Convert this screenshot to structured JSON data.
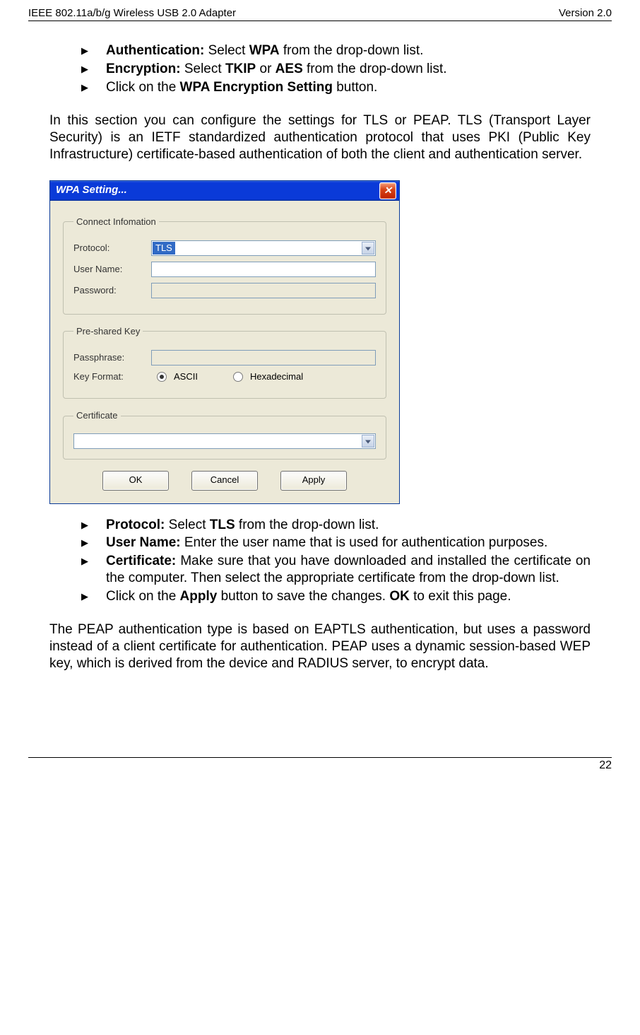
{
  "header": {
    "left": "IEEE 802.11a/b/g Wireless USB 2.0 Adapter",
    "right": "Version 2.0"
  },
  "bullets_top": [
    {
      "bold": "Authentication:",
      "rest": " Select ",
      "bold2": "WPA",
      "tail": " from the drop-down list."
    },
    {
      "bold": "Encryption:",
      "rest": " Select ",
      "bold2": "TKIP",
      "mid": " or ",
      "bold3": "AES",
      "tail": " from the drop-down list."
    },
    {
      "plain": "Click on the ",
      "bold2": "WPA Encryption Setting",
      "tail": " button."
    }
  ],
  "para1": "In this section you can configure the settings for TLS or PEAP.  TLS (Transport Layer Security) is an IETF standardized authentication protocol that uses PKI (Public Key Infrastructure) certificate-based authentication of both the client and authentication server.",
  "dialog": {
    "title": "WPA Setting...",
    "group1": {
      "legend": "Connect Infomation",
      "protocol_label": "Protocol:",
      "protocol_value": "TLS",
      "username_label": "User Name:",
      "password_label": "Password:"
    },
    "group2": {
      "legend": "Pre-shared Key",
      "passphrase_label": "Passphrase:",
      "keyformat_label": "Key Format:",
      "opt_ascii": "ASCII",
      "opt_hex": "Hexadecimal"
    },
    "group3": {
      "legend": "Certificate"
    },
    "buttons": {
      "ok": "OK",
      "cancel": "Cancel",
      "apply": "Apply"
    }
  },
  "bullets_bottom": {
    "b1_bold": "Protocol:",
    "b1_rest": " Select ",
    "b1_bold2": "TLS",
    "b1_tail": " from the drop-down list.",
    "b2_bold": "User Name:",
    "b2_rest": " Enter the user name that is used for authentication purposes.",
    "b3_bold": "Certificate:",
    "b3_rest": " Make sure that you have downloaded and installed the certificate on the computer. Then select the appropriate certificate from the drop-down list.",
    "b4_plain": "Click on the ",
    "b4_bold": "Apply",
    "b4_mid": " button to save the changes. ",
    "b4_bold2": "OK",
    "b4_tail": " to exit this page."
  },
  "para2": "The PEAP authentication type is based on EAPTLS authentication, but uses a password instead of a client certificate for authentication. PEAP uses a dynamic session-based WEP key, which is derived from the device and RADIUS server, to encrypt data.",
  "page_number": "22"
}
